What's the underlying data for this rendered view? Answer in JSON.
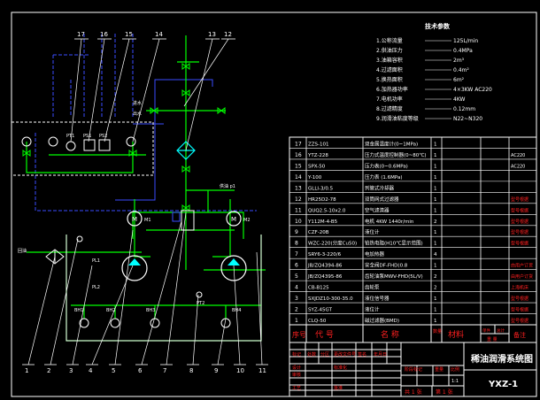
{
  "drawing": {
    "title": "稀油润滑系统图",
    "drawing_no": "YXZ-1",
    "sheet_total": "共 1 张",
    "sheet_no": "第 1 张"
  },
  "tech_params": {
    "heading": "技术参数",
    "items": [
      {
        "label": "1.公称流量",
        "value": "125L/min"
      },
      {
        "label": "2.供油压力",
        "value": "0.4MPa"
      },
      {
        "label": "3.油箱容积",
        "value": "2m³"
      },
      {
        "label": "4.过滤面积",
        "value": "0.4m²"
      },
      {
        "label": "5.换热面积",
        "value": "6m²"
      },
      {
        "label": "6.加热器功率",
        "value": "4×3KW AC220"
      },
      {
        "label": "7.电机功率",
        "value": "4KW"
      },
      {
        "label": "8.过滤精度",
        "value": "0.12mm"
      },
      {
        "label": "9.润滑油粘度等级",
        "value": "N22~N320"
      }
    ]
  },
  "callouts": {
    "top": [
      "17",
      "16",
      "15",
      "14",
      "13",
      "12"
    ],
    "bottom": [
      "1",
      "2",
      "3",
      "4",
      "5",
      "6",
      "7",
      "8",
      "9",
      "10",
      "11"
    ]
  },
  "diagram_labels": {
    "water_in": "进水",
    "water_out": "出水",
    "oil_in": "回油",
    "oil_out": "供油 p1",
    "components": [
      "PT1",
      "PS1",
      "PS2",
      "PL1",
      "PL2",
      "PT2",
      "M1",
      "M2",
      "BH1",
      "BH2",
      "BH3",
      "BH4"
    ]
  },
  "parts_list": [
    {
      "no": "17",
      "code": "ZZS-101",
      "name": "双金属温度计(0~1MPa)",
      "qty": "1",
      "note": ""
    },
    {
      "no": "16",
      "code": "YTZ-228",
      "name": "压力式温度控制器(0~80℃)",
      "qty": "1",
      "note": "AC220"
    },
    {
      "no": "15",
      "code": "SPX-50",
      "name": "压力表(0~0.6MPa)",
      "qty": "1",
      "note": "AC220"
    },
    {
      "no": "14",
      "code": "Y-100",
      "name": "压力表  (1.6MPa)",
      "qty": "1",
      "note": ""
    },
    {
      "no": "13",
      "code": "GLLI-3/0.5",
      "name": "列管式冷却器",
      "qty": "1",
      "note": ""
    },
    {
      "no": "12",
      "code": "HR25D2-78",
      "name": "双筒网式过滤器",
      "qty": "1",
      "note": "型号根据"
    },
    {
      "no": "11",
      "code": "QUQ2.5-10x2.0",
      "name": "空气滤清器",
      "qty": "1",
      "note": "型号根据"
    },
    {
      "no": "10",
      "code": "Y112M-4-B5",
      "name": "电机 4KW 1440r/min",
      "qty": "2",
      "note": "型号根据"
    },
    {
      "no": "9",
      "code": "CZF-20B",
      "name": "液位计",
      "qty": "1",
      "note": "型号根据"
    },
    {
      "no": "8",
      "code": "WZC-220(分度Cu50)",
      "name": "铂热电阻(H10℃显示范围)",
      "qty": "1",
      "note": "型号根据"
    },
    {
      "no": "7",
      "code": "SRY6-3-220/6",
      "name": "电加热器",
      "qty": "4",
      "note": ""
    },
    {
      "no": "6",
      "code": "JB/ZQ4394-86",
      "name": "安全阀DF-FHD(0.8",
      "qty": "1",
      "note": "由用户订货"
    },
    {
      "no": "5",
      "code": "JB/ZQ4395-86",
      "name": "齿轮油泵MWV-FHD(5L/V)",
      "qty": "2",
      "note": "由用户订货"
    },
    {
      "no": "4",
      "code": "CB-B125",
      "name": "齿轮泵",
      "qty": "2",
      "note": "上海机床"
    },
    {
      "no": "3",
      "code": "SXJDZ10-300-35.0",
      "name": "液位信号器",
      "qty": "1",
      "note": "型号根据"
    },
    {
      "no": "2",
      "code": "SYZ-45GT",
      "name": "液位计",
      "qty": "1",
      "note": "型号根据"
    },
    {
      "no": "1",
      "code": "CLQ-50",
      "name": "磁过滤器(BMD)",
      "qty": "1",
      "note": "型号根据"
    }
  ],
  "parts_header": {
    "no": "序号",
    "code": "代  号",
    "name": "名  称",
    "qty": "数量",
    "material": "材料",
    "weight_single": "单件",
    "weight_total": "总计",
    "weight": "重  量",
    "note": "备注"
  },
  "title_block": {
    "rows": [
      "标记",
      "处数",
      "分区",
      "更改文件号",
      "签名",
      "年月日"
    ],
    "design": "设计",
    "standard": "标准化",
    "review": "审核",
    "process": "工艺",
    "approve": "批准",
    "stage": "阶段标记",
    "weight": "重量",
    "scale": "比例",
    "scale_value": "1:1"
  },
  "colors": {
    "background": "#000000",
    "frame": "#ffffff",
    "pipe_green": "#00ff00",
    "water_blue": "#3a4dff",
    "valve_green": "#00ff00",
    "text_white": "#ffffff",
    "text_red": "#ff2020",
    "pump_cyan": "#00ffff",
    "note_yellow": "#ffff00",
    "note_red": "#ff0000"
  }
}
